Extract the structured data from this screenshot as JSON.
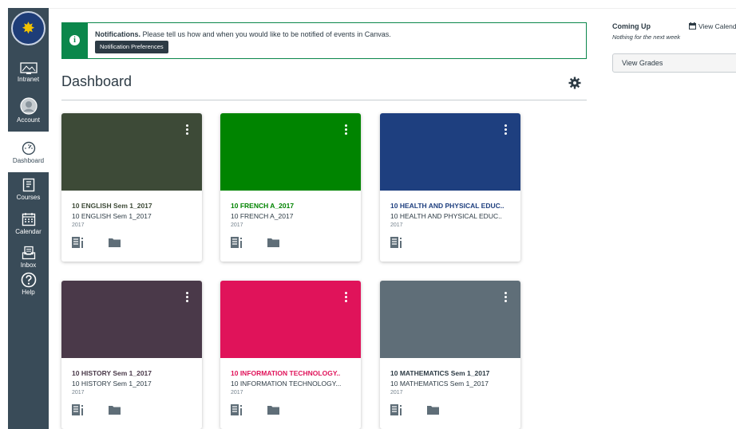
{
  "nav": {
    "items": [
      {
        "label": "Intranet"
      },
      {
        "label": "Account"
      },
      {
        "label": "Dashboard"
      },
      {
        "label": "Courses"
      },
      {
        "label": "Calendar"
      },
      {
        "label": "Inbox"
      },
      {
        "label": "Help"
      }
    ]
  },
  "notification": {
    "title": "Notifications.",
    "message": "Please tell us how and when you would like to be notified of events in Canvas.",
    "button_label": "Notification Preferences",
    "color": "#0b874b"
  },
  "dashboard": {
    "title": "Dashboard"
  },
  "cards": [
    {
      "title": "10 ENGLISH Sem 1_2017",
      "subtitle": "10 ENGLISH Sem 1_2017",
      "term": "2017",
      "color": "#3d4a37",
      "icons": [
        "announcements-icon",
        "files-icon"
      ]
    },
    {
      "title": "10 FRENCH A_2017",
      "subtitle": "10 FRENCH A_2017",
      "term": "2017",
      "color": "#008400",
      "icons": [
        "announcements-icon",
        "files-icon"
      ]
    },
    {
      "title": "10 HEALTH AND PHYSICAL EDUC..",
      "subtitle": "10 HEALTH AND PHYSICAL EDUC..",
      "term": "2017",
      "color": "#1e3f7f",
      "icons": [
        "announcements-icon"
      ]
    },
    {
      "title": "10 HISTORY Sem 1_2017",
      "subtitle": "10 HISTORY Sem 1_2017",
      "term": "2017",
      "color": "#4a3949",
      "icons": [
        "announcements-icon",
        "files-icon"
      ]
    },
    {
      "title": "10 INFORMATION TECHNOLOGY..",
      "subtitle": "10 INFORMATION TECHNOLOGY...",
      "term": "2017",
      "color": "#e0135a",
      "icons": [
        "announcements-icon",
        "files-icon"
      ]
    },
    {
      "title": "10 MATHEMATICS Sem 1_2017",
      "subtitle": "10 MATHEMATICS Sem 1_2017",
      "term": "2017",
      "color": "#5f6e78",
      "icons": [
        "announcements-icon",
        "files-icon"
      ]
    }
  ],
  "sidebar": {
    "coming_up": "Coming Up",
    "view_calendar": "View Calenda",
    "nothing": "Nothing for the next week",
    "view_grades": "View Grades"
  }
}
